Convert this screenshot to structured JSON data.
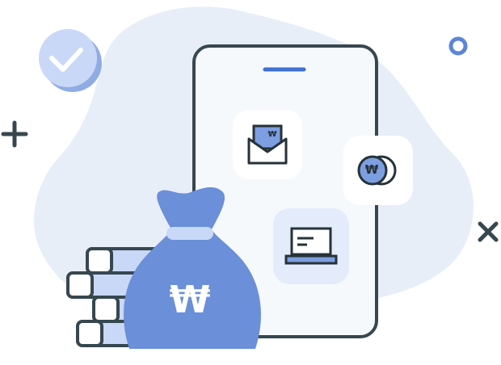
{
  "illustration": {
    "currency_symbol": "₩",
    "icons": [
      "check-circle-icon",
      "plus-icon",
      "ring-icon",
      "close-icon",
      "smartphone-icon",
      "envelope-won-icon",
      "coin-won-icon",
      "laptop-icon",
      "money-bag-won-icon",
      "stacked-coins-icon"
    ],
    "colors": {
      "background_blob": "#e8eef8",
      "accent_blue": "#6b8fd8",
      "dark_outline": "#37474f",
      "light_blue": "#c7d7f5",
      "phone_fill": "#f6f9fc"
    }
  }
}
